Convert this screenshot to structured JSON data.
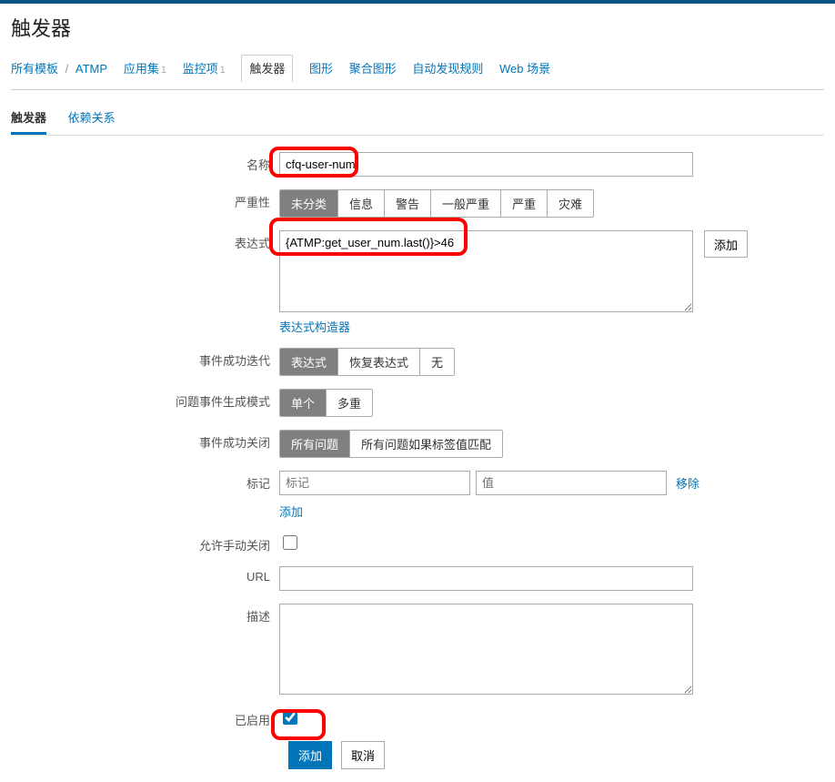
{
  "page": {
    "title": "触发器"
  },
  "breadcrumb": {
    "all_templates": "所有模板",
    "template": "ATMP"
  },
  "topnav": {
    "apps": "应用集",
    "apps_n": "1",
    "items": "监控项",
    "items_n": "1",
    "triggers": "触发器",
    "graphs": "图形",
    "screens": "聚合图形",
    "discovery": "自动发现规则",
    "web": "Web 场景"
  },
  "secTabs": {
    "triggers": "触发器",
    "deps": "依赖关系"
  },
  "labels": {
    "name": "名称",
    "severity": "严重性",
    "expression": "表达式",
    "expr_builder": "表达式构造器",
    "ok_gen": "事件成功迭代",
    "problem_mode": "问题事件生成模式",
    "ok_close": "事件成功关闭",
    "tags": "标记",
    "manual_close": "允许手动关闭",
    "url": "URL",
    "description": "描述",
    "enabled": "已启用"
  },
  "values": {
    "name": "cfq-user-num",
    "expression": "{ATMP:get_user_num.last()}>46",
    "url": "",
    "description": "",
    "enabled": true,
    "manual_close": false
  },
  "severity": [
    "未分类",
    "信息",
    "警告",
    "一般严重",
    "严重",
    "灾难"
  ],
  "ok_gen": {
    "options": [
      "表达式",
      "恢复表达式",
      "无"
    ],
    "selected": 0
  },
  "problem_mode": {
    "options": [
      "单个",
      "多重"
    ],
    "selected": 0
  },
  "ok_close": {
    "options": [
      "所有问题",
      "所有问题如果标签值匹配"
    ],
    "selected": 0
  },
  "tag": {
    "key_ph": "标记",
    "val_ph": "值",
    "remove": "移除",
    "add": "添加"
  },
  "buttons": {
    "add": "添加",
    "cancel": "取消",
    "expr_add": "添加"
  }
}
